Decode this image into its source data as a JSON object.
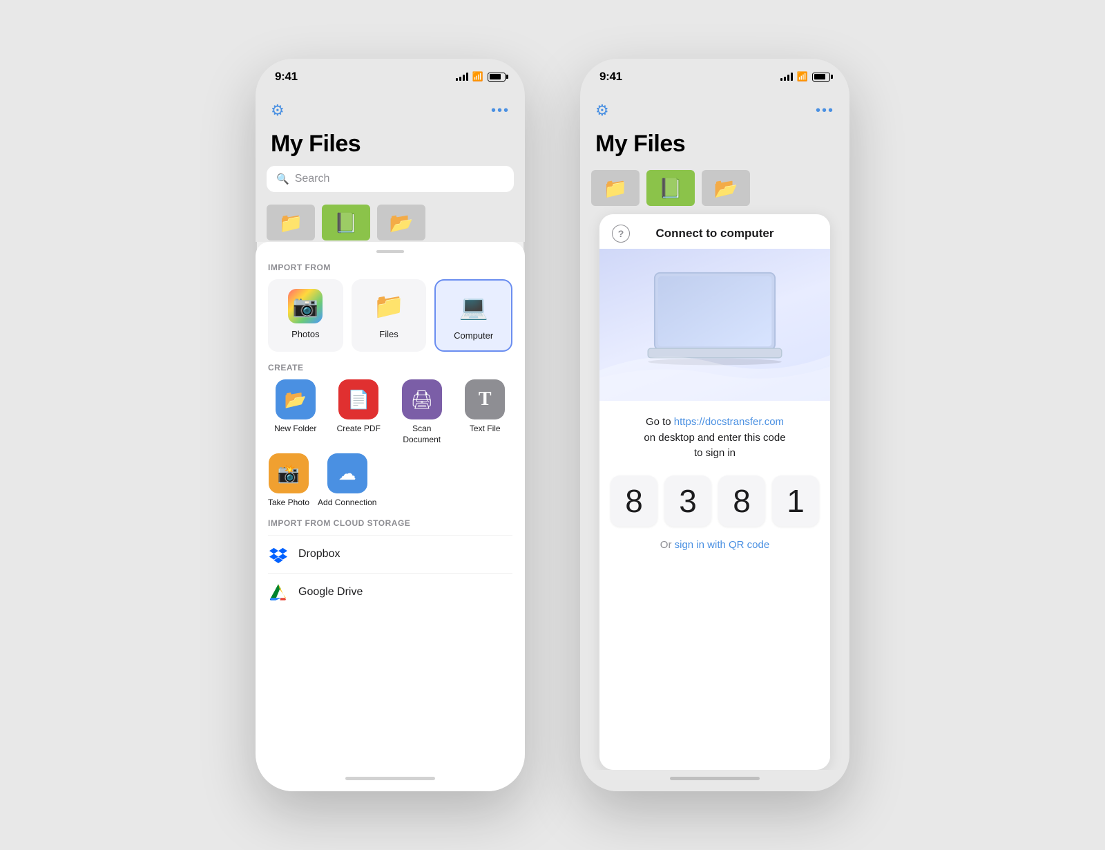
{
  "phone1": {
    "status": {
      "time": "9:41",
      "signal": "●●●●",
      "wifi": "wifi",
      "battery": "battery"
    },
    "nav": {
      "settings_label": "⚙",
      "more_label": "•••"
    },
    "title": "My Files",
    "search_placeholder": "Search",
    "import_section_label": "IMPORT FROM",
    "import_items": [
      {
        "label": "Photos",
        "icon": "📷"
      },
      {
        "label": "Files",
        "icon": "📁"
      },
      {
        "label": "Computer",
        "icon": "💻",
        "highlighted": true
      }
    ],
    "create_section_label": "CREATE",
    "create_items": [
      {
        "label": "New Folder",
        "icon": "📂",
        "color": "#4a90e2"
      },
      {
        "label": "Create PDF",
        "icon": "📄",
        "color": "#e03030"
      },
      {
        "label": "Scan Document",
        "icon": "🖨",
        "color": "#7b5ea7"
      },
      {
        "label": "Text File",
        "icon": "T",
        "color": "#8e8e93"
      }
    ],
    "create_row2_items": [
      {
        "label": "Take Photo",
        "icon": "📸",
        "color": "#f0a030"
      },
      {
        "label": "Add Connection",
        "icon": "☁",
        "color": "#4a90e2"
      }
    ],
    "cloud_section_label": "IMPORT FROM CLOUD STORAGE",
    "cloud_items": [
      {
        "label": "Dropbox",
        "icon": "dropbox"
      },
      {
        "label": "Google Drive",
        "icon": "gdrive"
      }
    ]
  },
  "phone2": {
    "status": {
      "time": "9:41"
    },
    "nav": {
      "settings_label": "⚙",
      "more_label": "•••"
    },
    "title": "My Files",
    "modal": {
      "title": "Connect to computer",
      "help": "?",
      "instruction_before": "Go to ",
      "instruction_link": "https://docstransfer.com",
      "instruction_after": "\non desktop and enter this code\nto sign in",
      "code_digits": [
        "8",
        "3",
        "8",
        "1"
      ],
      "qr_prefix": "Or ",
      "qr_link": "sign in with QR code"
    }
  }
}
